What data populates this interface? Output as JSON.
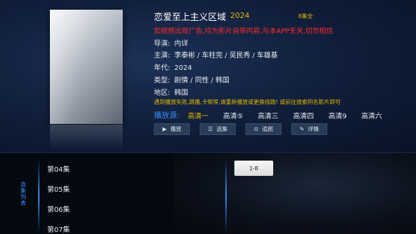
{
  "show": {
    "title": "恋爱至上主义区域",
    "year": "2024",
    "episodes_count": "8集全",
    "warning": "如视频出现广告,均为影片自带内容,与本APP无关,切勿相信",
    "director_label": "导演:",
    "director": "内详",
    "cast_label": "主演:",
    "cast": "李泰彬 / 车柱完 / 吴民秀 / 车雄基",
    "year_label": "年代:",
    "year_value": "2024",
    "genre_label": "类型:",
    "genre": "剧情 / 同性 / 韩国",
    "region_label": "地区:",
    "region": "韩国",
    "notice": "遇到播放失败,跳播,卡顿等,请重新播放或更换线路! 或前往搜索同名影片即可"
  },
  "sources": {
    "label": "播放源:",
    "items": [
      "高清一",
      "高清⑤",
      "高清三",
      "高清四",
      "高清9",
      "高清六"
    ]
  },
  "actions": {
    "play": "播放",
    "select": "选集",
    "follow": "追剧",
    "detail": "详情"
  },
  "episode_list": {
    "tab_label": "选集列表",
    "items": [
      "第04集",
      "第05集",
      "第06集",
      "第07集"
    ],
    "range": "1-8"
  },
  "colors": {
    "accent": "#3a8fff",
    "highlight": "#e6b800",
    "warning": "#ff2a2a"
  }
}
